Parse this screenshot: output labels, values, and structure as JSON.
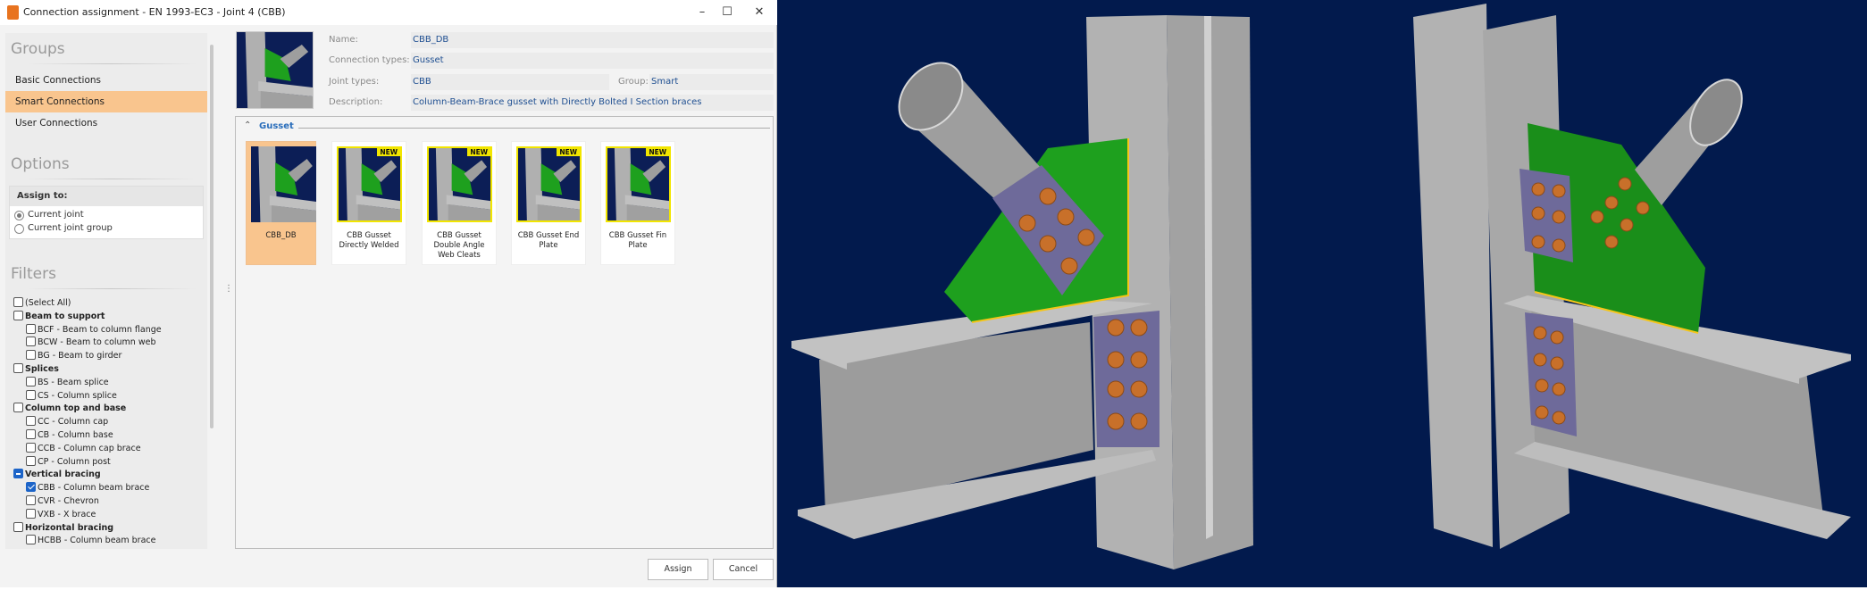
{
  "window": {
    "title": "Connection assignment - EN 1993-EC3 - Joint 4 (CBB)",
    "minimize": "–",
    "maximize": "☐",
    "close": "✕"
  },
  "sidebar": {
    "groups_heading": "Groups",
    "groups": [
      {
        "label": "Basic Connections",
        "selected": false
      },
      {
        "label": "Smart Connections",
        "selected": true
      },
      {
        "label": "User Connections",
        "selected": false
      }
    ],
    "options_heading": "Options",
    "assign_to": {
      "label": "Assign to:",
      "options": [
        {
          "label": "Current joint",
          "selected": true
        },
        {
          "label": "Current joint group",
          "selected": false
        }
      ]
    },
    "filters_heading": "Filters",
    "filters": [
      {
        "label": "(Select All)",
        "level": 0,
        "state": "unchecked",
        "bold": false
      },
      {
        "label": "Beam to support",
        "level": 0,
        "state": "unchecked",
        "bold": true
      },
      {
        "label": "BCF - Beam to column flange",
        "level": 1,
        "state": "unchecked",
        "bold": false
      },
      {
        "label": "BCW - Beam to column web",
        "level": 1,
        "state": "unchecked",
        "bold": false
      },
      {
        "label": "BG - Beam to girder",
        "level": 1,
        "state": "unchecked",
        "bold": false
      },
      {
        "label": "Splices",
        "level": 0,
        "state": "unchecked",
        "bold": true
      },
      {
        "label": "BS - Beam splice",
        "level": 1,
        "state": "unchecked",
        "bold": false
      },
      {
        "label": "CS - Column splice",
        "level": 1,
        "state": "unchecked",
        "bold": false
      },
      {
        "label": "Column top and base",
        "level": 0,
        "state": "unchecked",
        "bold": true
      },
      {
        "label": "CC - Column cap",
        "level": 1,
        "state": "unchecked",
        "bold": false
      },
      {
        "label": "CB - Column base",
        "level": 1,
        "state": "unchecked",
        "bold": false
      },
      {
        "label": "CCB - Column cap brace",
        "level": 1,
        "state": "unchecked",
        "bold": false
      },
      {
        "label": "CP - Column post",
        "level": 1,
        "state": "unchecked",
        "bold": false
      },
      {
        "label": "Vertical bracing",
        "level": 0,
        "state": "partial",
        "bold": true
      },
      {
        "label": "CBB - Column beam brace",
        "level": 1,
        "state": "checked",
        "bold": false
      },
      {
        "label": "CVR - Chevron",
        "level": 1,
        "state": "unchecked",
        "bold": false
      },
      {
        "label": "VXB - X brace",
        "level": 1,
        "state": "unchecked",
        "bold": false
      },
      {
        "label": "Horizontal bracing",
        "level": 0,
        "state": "unchecked",
        "bold": true
      },
      {
        "label": "HCBB - Column beam brace",
        "level": 1,
        "state": "unchecked",
        "bold": false
      }
    ]
  },
  "details": {
    "name_label": "Name:",
    "name": "CBB_DB",
    "types_label": "Connection types:",
    "types": "Gusset",
    "joint_label": "Joint types:",
    "joint": "CBB",
    "group_label": "Group:",
    "group": "Smart",
    "desc_label": "Description:",
    "desc": "Column-Beam-Brace gusset with Directly Bolted I Section braces"
  },
  "gallery": {
    "section": "Gusset",
    "collapse_icon": "double-chevron-up-icon",
    "new_badge": "NEW",
    "cards": [
      {
        "label": "CBB_DB",
        "selected": true,
        "is_new": false
      },
      {
        "label": "CBB Gusset Directly Welded",
        "selected": false,
        "is_new": true
      },
      {
        "label": "CBB Gusset Double Angle Web Cleats",
        "selected": false,
        "is_new": true
      },
      {
        "label": "CBB Gusset End Plate",
        "selected": false,
        "is_new": true
      },
      {
        "label": "CBB Gusset Fin Plate",
        "selected": false,
        "is_new": true
      }
    ]
  },
  "buttons": {
    "assign": "Assign",
    "cancel": "Cancel"
  },
  "colors": {
    "accent": "#f9c58e",
    "viewport_bg": "#021a4d",
    "gusset": "#1a9a1a",
    "bolt": "#c8702a",
    "plate": "#6e6a9a",
    "steel": "#b4b4b4"
  }
}
